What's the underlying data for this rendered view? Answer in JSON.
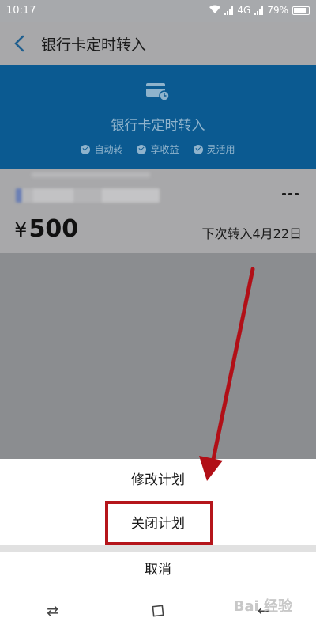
{
  "status": {
    "time": "10:17",
    "network": "4G",
    "battery": "79%"
  },
  "header": {
    "title": "银行卡定时转入"
  },
  "banner": {
    "heading": "银行卡定时转入",
    "features": [
      "自动转",
      "享收益",
      "灵活用"
    ]
  },
  "plan": {
    "currency": "¥",
    "amount": "500",
    "next_transfer": "下次转入4月22日"
  },
  "sheet": {
    "edit_label": "修改计划",
    "close_label": "关闭计划",
    "cancel_label": "取消"
  },
  "nav": {
    "back": "back-icon",
    "home": "home-icon",
    "recent": "recent-icon"
  },
  "watermark": "Bai 经验",
  "colors": {
    "banner": "#0b5a91",
    "highlight": "#b5151b",
    "arrow": "#b10f17"
  }
}
